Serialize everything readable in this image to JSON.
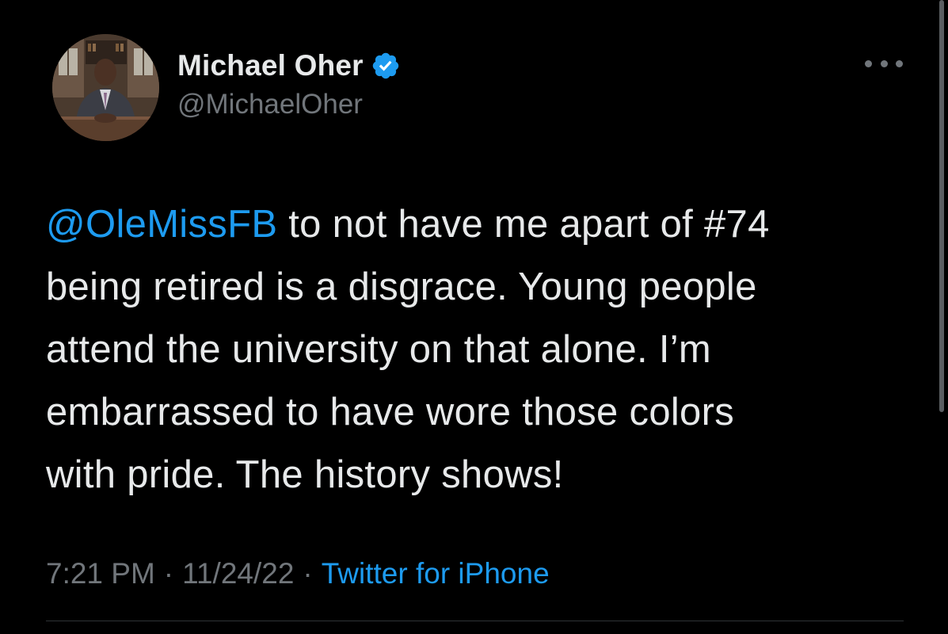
{
  "tweet": {
    "author": {
      "display_name": "Michael Oher",
      "handle": "@MichaelOher",
      "verified": true,
      "verified_icon": "verified-badge-icon",
      "avatar": "profile-photo"
    },
    "more_icon": "more-options-icon",
    "text": {
      "mention": "@OleMissFB",
      "line1_rest": " to not have me apart of #74",
      "line2": "being retired is a disgrace. Young people",
      "line3": "attend the university on that alone. I’m",
      "line4": "embarrassed to have wore those colors",
      "line5": "with pride. The history shows!"
    },
    "meta": {
      "time": "7:21 PM",
      "separator": "·",
      "date": "11/24/22",
      "source": "Twitter for iPhone"
    }
  },
  "colors": {
    "background": "#000000",
    "text": "#e7e9ea",
    "secondary": "#71767b",
    "accent": "#1d9bf0",
    "divider": "#2f3336"
  }
}
